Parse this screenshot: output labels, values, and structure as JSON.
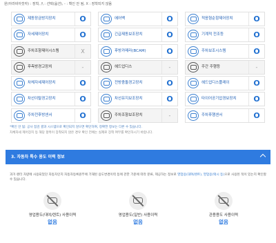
{
  "legend": "원(아라비아숫자) : 장착, /\\ : 선택(옵션), - : 확인 안 됨, X : 장착되지 않음",
  "grid": [
    [
      {
        "label": "제동장금방지장치",
        "value": "O",
        "icon": "abs-icon"
      },
      {
        "label": "자세제어장치",
        "value": "O",
        "icon": "esc-icon"
      },
      {
        "label": "주차조향제어시스템",
        "value": "X",
        "icon": "parking-steering-icon",
        "gray": true
      },
      {
        "label": "후측방경고장치",
        "value": "-",
        "icon": "blind-spot-icon",
        "gray": true
      },
      {
        "label": "차체자세제어장치",
        "value": "O",
        "icon": "stability-control-icon"
      },
      {
        "label": "차선이탈경고장치",
        "value": "O",
        "icon": "lane-departure-icon"
      },
      {
        "label": "주차전후방센서",
        "value": "O",
        "icon": "parking-sensor-icon"
      }
    ],
    [
      {
        "label": "에어백",
        "value": "O",
        "icon": "airbag-icon"
      },
      {
        "label": "긴급제동보조장치",
        "value": "O",
        "icon": "emergency-brake-icon"
      },
      {
        "label": "후방카메라(BCAM)",
        "value": "O",
        "icon": "rear-camera-icon"
      },
      {
        "label": "헤드업디스",
        "value": "-",
        "icon": "head-up-display-icon",
        "gray": true
      },
      {
        "label": "전방충돌경고장치",
        "value": "O",
        "icon": "forward-collision-icon"
      },
      {
        "label": "차선유지보조장치",
        "value": "O",
        "icon": "lane-keep-icon"
      },
      {
        "label": "주차조향보조장치",
        "value": "-",
        "icon": "parking-assist-icon",
        "gray": true
      }
    ],
    [
      {
        "label": "적응형순항제어장치",
        "value": "O",
        "icon": "adaptive-cruise-icon"
      },
      {
        "label": "기계적 전조등",
        "value": "O",
        "icon": "headlamp-icon"
      },
      {
        "label": "주차보조시스템",
        "value": "O",
        "icon": "parking-system-icon"
      },
      {
        "label": "주간 주행등",
        "value": "-",
        "icon": "daytime-light-icon",
        "gray": true
      },
      {
        "label": "헤드업디스플레이",
        "value": "O",
        "icon": "hud-icon"
      },
      {
        "label": "타이어공기압경보장치",
        "value": "O",
        "icon": "tire-pressure-icon"
      },
      {
        "label": "주차후행센서",
        "value": "O",
        "icon": "rear-sensor-icon"
      }
    ]
  ],
  "note1": "*확인 안 됨: 공사 점검 결과 시스템으로 확인되지 않으면 확인하여, 정확한 정보는 다른 수 있습니다.",
  "note2": "차체자세 제어장치 등 해당 항목이 장착되지 않은 경우 확인 전에는 실제로 장착 여부를 확인하시기 바랍니다.",
  "section": {
    "title": "3. 자동차 특수 용도 이력 정보"
  },
  "desc_text": "과거 렌터 차량에 사용되었던 자동차인지 자동차등록원부에 기재된 용도변경이력 등에 관한 기준에 따라 분류, 제공하는 정보로 ",
  "desc_link": "영업용(대여/렌트), 영업용(택시 등)",
  "desc_tail": "으로 사용된 적이 있는지 확인할 수 있습니다.",
  "items": [
    {
      "label": "영업용도(대여/렌트) 사용이력",
      "value": "없음",
      "icon": "rental-car-icon"
    },
    {
      "label": "영업용도(일반) 사용이력",
      "value": "없음",
      "icon": "commercial-car-icon"
    },
    {
      "label": "관용용도 사용이력",
      "value": "없음",
      "icon": "government-car-icon"
    }
  ]
}
